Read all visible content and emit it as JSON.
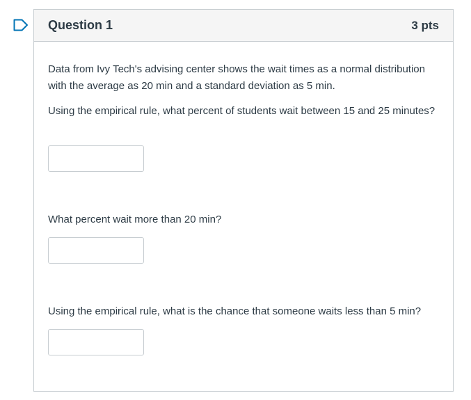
{
  "question": {
    "title": "Question 1",
    "points": "3 pts",
    "paragraphs": [
      "Data from Ivy Tech's advising center shows the wait times as a normal distribution with the average as 20 min and a standard deviation as 5 min.",
      "Using the empirical rule, what percent of students wait between 15 and 25 minutes?",
      "What percent wait more than 20 min?",
      "Using the empirical rule, what is the chance that someone waits less than 5 min?"
    ],
    "answers": [
      {
        "value": ""
      },
      {
        "value": ""
      },
      {
        "value": ""
      }
    ]
  },
  "colors": {
    "flag": "#0374b5",
    "border": "#c7cdd1",
    "header_bg": "#f5f5f5",
    "text": "#2d3b45"
  },
  "icons": {
    "flag": "flag-icon"
  }
}
